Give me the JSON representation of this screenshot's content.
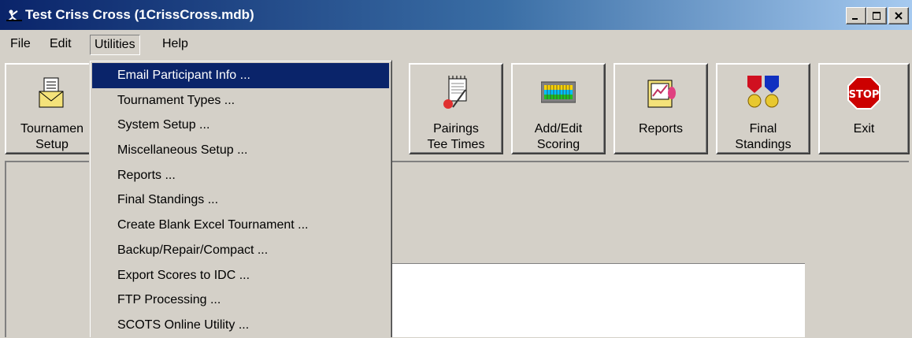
{
  "window": {
    "title": "Test Criss Cross (1CrissCross.mdb)",
    "controls": {
      "minimize": "_",
      "maximize": "□",
      "close": "×"
    }
  },
  "menubar": {
    "items": [
      {
        "label": "File"
      },
      {
        "label": "Edit"
      },
      {
        "label": "Utilities",
        "open": true
      },
      {
        "label": "Help"
      }
    ]
  },
  "toolbar": {
    "buttons": [
      {
        "label": "Tournamen\nSetup",
        "icon": "tournament-envelope-icon"
      },
      {
        "label": "Pairings\nTee Times",
        "icon": "pairings-notepad-icon"
      },
      {
        "label": "Add/Edit\nScoring",
        "icon": "scoring-grid-icon"
      },
      {
        "label": "Reports",
        "icon": "reports-clipboard-icon"
      },
      {
        "label": "Final\nStandings",
        "icon": "medals-icon"
      },
      {
        "label": "Exit",
        "icon": "stop-sign-icon"
      }
    ]
  },
  "utilities_menu": {
    "items": [
      {
        "label": "Email Participant Info ...",
        "selected": true
      },
      {
        "label": "Tournament Types ..."
      },
      {
        "label": "System Setup ..."
      },
      {
        "label": "Miscellaneous Setup ..."
      },
      {
        "label": "Reports ..."
      },
      {
        "label": "Final Standings ..."
      },
      {
        "label": "Create Blank Excel Tournament ..."
      },
      {
        "label": "Backup/Repair/Compact ..."
      },
      {
        "label": "Export Scores to IDC ..."
      },
      {
        "label": "FTP Processing ..."
      },
      {
        "label": "SCOTS Online Utility ..."
      }
    ]
  },
  "colors": {
    "titlebar_start": "#0a246a",
    "titlebar_end": "#a6caf0",
    "face": "#d4d0c8",
    "highlight": "#0a246a",
    "stop_red": "#cc0000"
  }
}
